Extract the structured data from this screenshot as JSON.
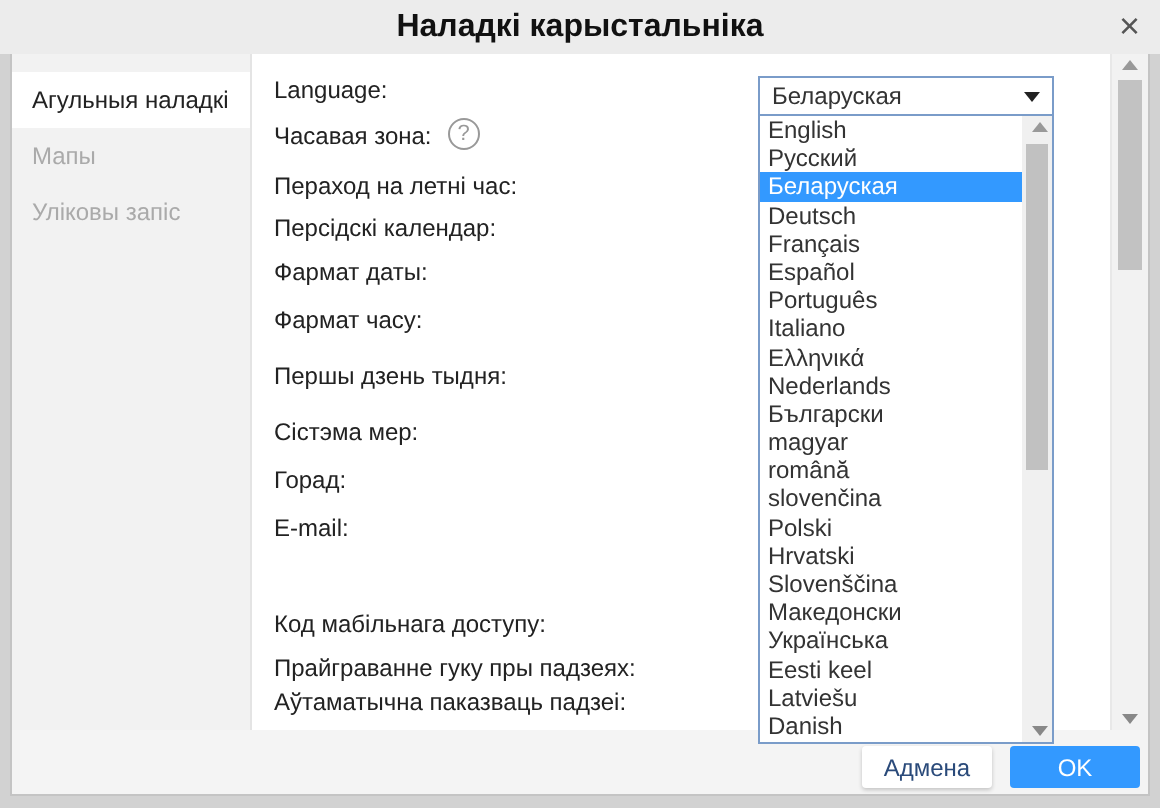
{
  "window": {
    "title": "Наладкі карыстальніка",
    "close": "×"
  },
  "sidebar": {
    "items": [
      {
        "label": "Агульныя наладкі",
        "selected": true
      },
      {
        "label": "Мапы",
        "selected": false
      },
      {
        "label": "Уліковы запіс",
        "selected": false
      }
    ]
  },
  "settings": [
    {
      "label": "Language:",
      "kind": "plain"
    },
    {
      "label": "Часавая зона:",
      "kind": "help",
      "help_icon": "?"
    },
    {
      "label": "Пераход на летні час:",
      "kind": "plain"
    },
    {
      "label": "Персідскі календар:",
      "kind": "plain"
    },
    {
      "label": "Фармат даты:",
      "kind": "plain"
    },
    {
      "label": "Фармат часу:",
      "kind": "plain"
    },
    {
      "label": "Першы дзень тыдня:",
      "kind": "plain"
    },
    {
      "label": "Сістэма мер:",
      "kind": "plain"
    },
    {
      "label": "Горад:",
      "kind": "plain"
    },
    {
      "label": "E-mail:",
      "kind": "plain"
    },
    {
      "label": "Код мабільнага доступу:",
      "kind": "plain"
    },
    {
      "label": "Прайграванне гуку пры падзеях:",
      "kind": "plain"
    },
    {
      "label": "Аўтаматычна паказваць падзеі:",
      "kind": "plain"
    }
  ],
  "language_select": {
    "value": "Беларуская",
    "options": [
      {
        "label": "English",
        "selected": false
      },
      {
        "label": "Русский",
        "selected": false
      },
      {
        "label": "Беларуская",
        "selected": true
      },
      {
        "label": "Deutsch",
        "selected": false
      },
      {
        "label": "Français",
        "selected": false
      },
      {
        "label": "Español",
        "selected": false
      },
      {
        "label": "Português",
        "selected": false
      },
      {
        "label": "Italiano",
        "selected": false
      },
      {
        "label": "Ελληνικά",
        "selected": false
      },
      {
        "label": "Nederlands",
        "selected": false
      },
      {
        "label": "Български",
        "selected": false
      },
      {
        "label": "magyar",
        "selected": false
      },
      {
        "label": "română",
        "selected": false
      },
      {
        "label": "slovenčina",
        "selected": false
      },
      {
        "label": "Polski",
        "selected": false
      },
      {
        "label": "Hrvatski",
        "selected": false
      },
      {
        "label": "Slovenščina",
        "selected": false
      },
      {
        "label": "Македонски",
        "selected": false
      },
      {
        "label": "Українська",
        "selected": false
      },
      {
        "label": "Eesti keel",
        "selected": false
      },
      {
        "label": "Latviešu",
        "selected": false
      },
      {
        "label": "Danish",
        "selected": false
      }
    ]
  },
  "buttons": [
    {
      "label": "Адмена",
      "kind": "secondary"
    },
    {
      "label": "OK",
      "kind": "primary"
    }
  ]
}
